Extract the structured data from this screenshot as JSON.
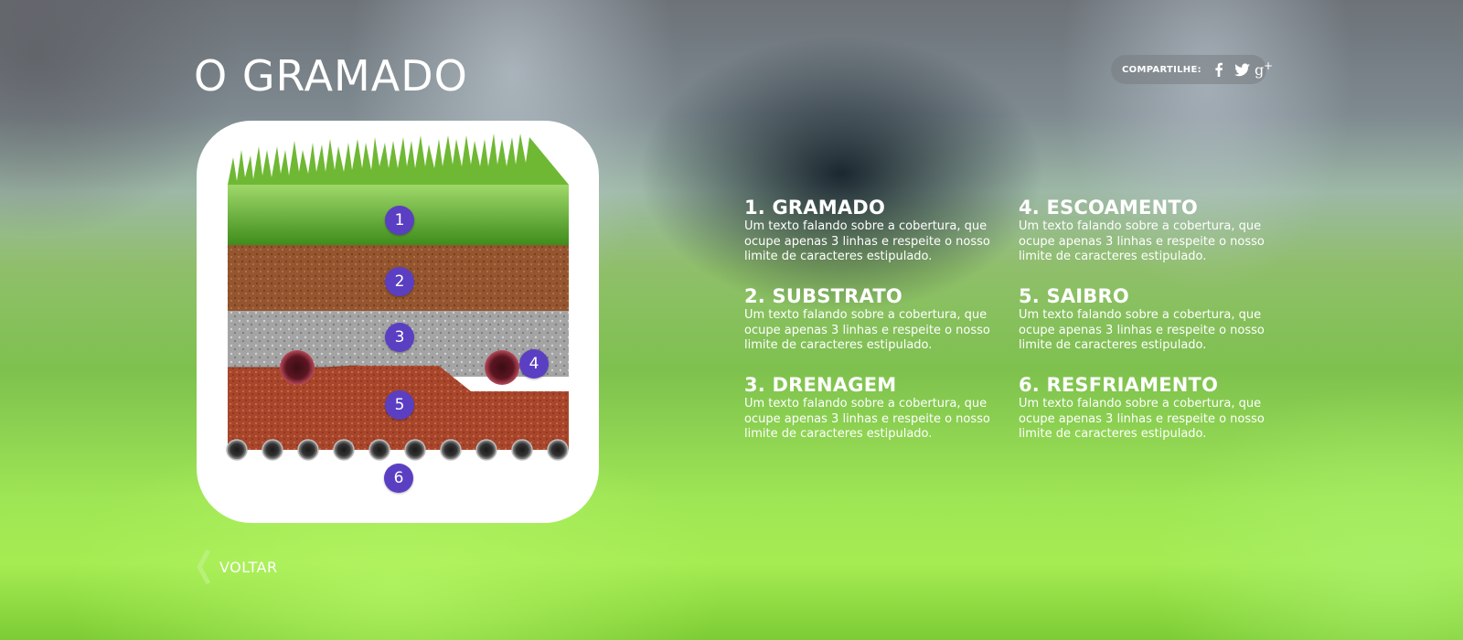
{
  "page": {
    "title": "O GRAMADO"
  },
  "share": {
    "label": "COMPARTILHE:",
    "icons": [
      "facebook-icon",
      "twitter-icon",
      "google-plus-icon"
    ]
  },
  "diagram": {
    "markers": [
      "1",
      "2",
      "3",
      "4",
      "5",
      "6"
    ],
    "colors": {
      "marker": "#5b3fc2",
      "grass": "#5fae2a",
      "substrate": "#9a5a33",
      "gravel": "#a7a7a7",
      "clay": "#a9492f",
      "pipe": "#7c1f2a"
    }
  },
  "info": [
    {
      "title": "1. GRAMADO",
      "text": "Um texto falando sobre a cobertura, que ocupe apenas 3 linhas e respeite o nosso limite de caracteres estipulado."
    },
    {
      "title": "2. SUBSTRATO",
      "text": "Um texto falando sobre a cobertura, que ocupe apenas 3 linhas e respeite o nosso limite de caracteres estipulado."
    },
    {
      "title": "3. DRENAGEM",
      "text": "Um texto falando sobre a cobertura, que ocupe apenas 3 linhas e respeite o nosso limite de caracteres estipulado."
    },
    {
      "title": "4. ESCOAMENTO",
      "text": "Um texto falando sobre a cobertura, que ocupe apenas 3 linhas e respeite o nosso limite de caracteres estipulado."
    },
    {
      "title": "5. SAIBRO",
      "text": "Um texto falando sobre a cobertura, que ocupe apenas 3 linhas e respeite o nosso limite de caracteres estipulado."
    },
    {
      "title": "6. RESFRIAMENTO",
      "text": "Um texto falando sobre a cobertura, que ocupe apenas 3 linhas e respeite o nosso limite de caracteres estipulado."
    }
  ],
  "nav": {
    "back_label": "VOLTAR"
  }
}
